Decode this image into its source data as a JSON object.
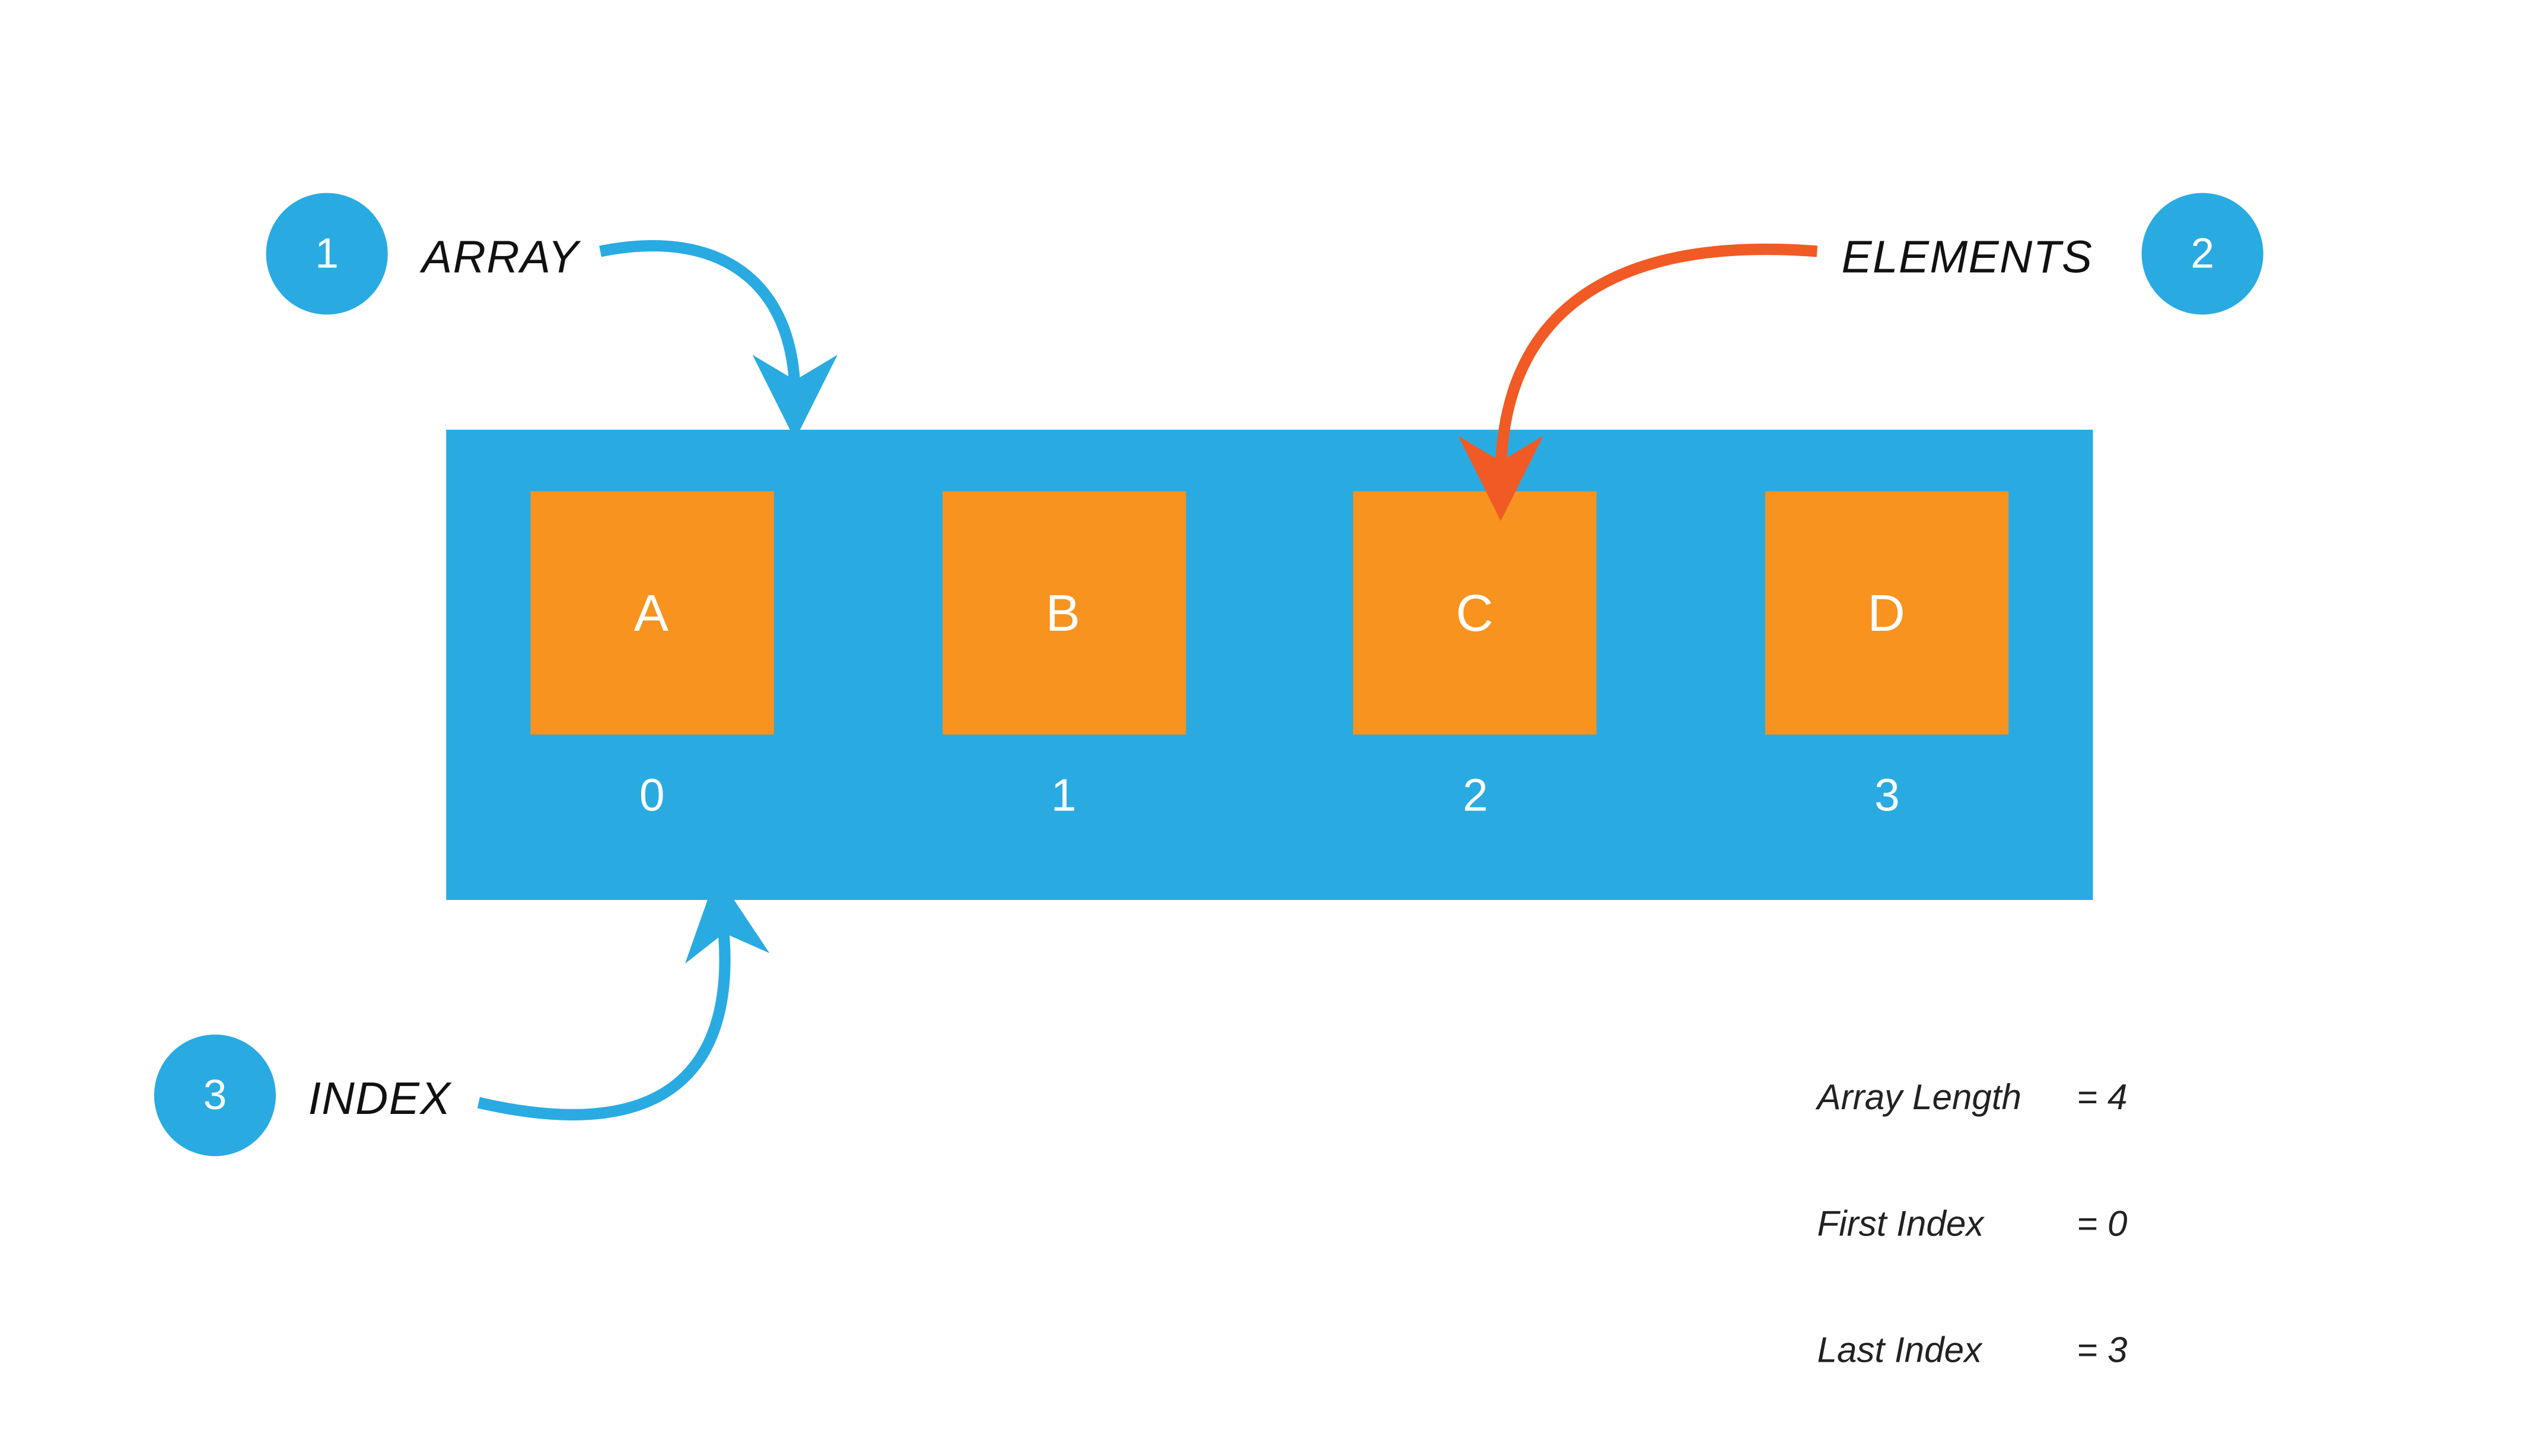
{
  "badges": {
    "array": "1",
    "elements": "2",
    "index": "3"
  },
  "labels": {
    "array": "ARRAY",
    "elements": "ELEMENTS",
    "index": "INDEX"
  },
  "array": {
    "cells": [
      {
        "value": "A",
        "index": "0"
      },
      {
        "value": "B",
        "index": "1"
      },
      {
        "value": "C",
        "index": "2"
      },
      {
        "value": "D",
        "index": "3"
      }
    ]
  },
  "info": {
    "length_key": "Array Length",
    "length_val": "= 4",
    "first_key": "First Index",
    "first_val": "= 0",
    "last_key": "Last Index",
    "last_val": "= 3"
  },
  "colors": {
    "blue": "#29ABE2",
    "orange": "#F7931E"
  }
}
